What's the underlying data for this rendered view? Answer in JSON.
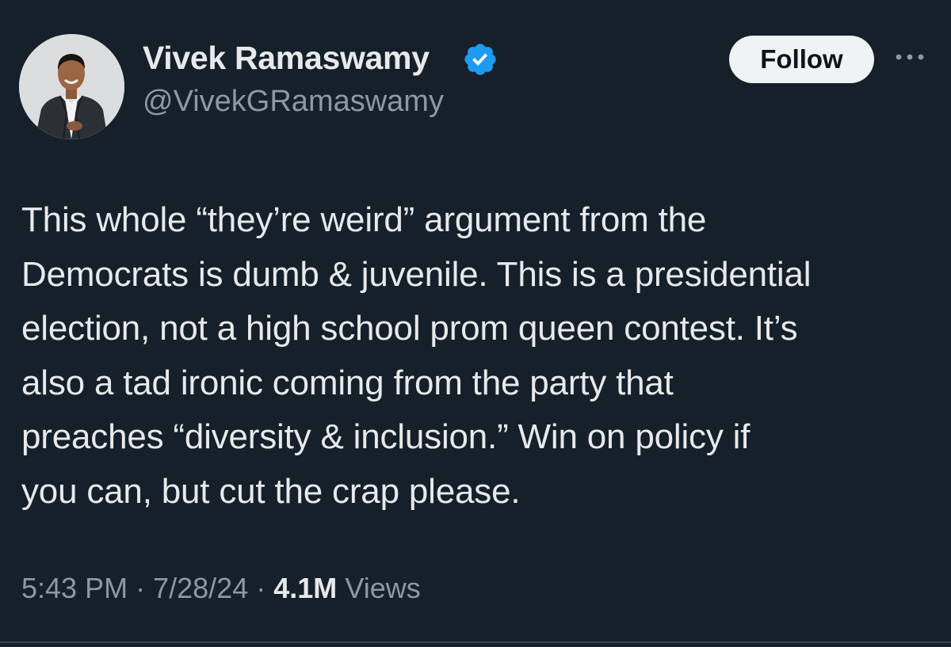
{
  "author": {
    "name": "Vivek Ramaswamy",
    "handle": "@VivekGRamaswamy",
    "verified": true,
    "avatar_icon": "profile-photo"
  },
  "actions": {
    "follow_label": "Follow",
    "more_icon": "more-horizontal-icon"
  },
  "tweet": {
    "lines": [
      "This whole “they’re weird” argument from the",
      "Democrats is dumb & juvenile. This is a presidential",
      "election, not a high school prom queen contest. It’s",
      "also a tad ironic coming from the party that",
      "preaches “diversity & inclusion.” Win on policy if",
      "you can, but cut the crap please."
    ]
  },
  "meta": {
    "time": "5:43 PM",
    "separator": "·",
    "date": "7/28/24",
    "views_count": "4.1M",
    "views_label": "Views"
  },
  "colors": {
    "background": "#15202b",
    "text_primary": "#e7e9ea",
    "text_secondary": "#8b98a5",
    "verified_blue": "#1d9bf0",
    "follow_bg": "#eff3f4",
    "divider": "#38444d"
  }
}
